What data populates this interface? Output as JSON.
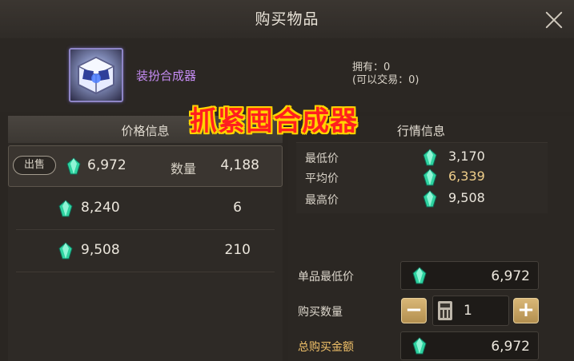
{
  "window": {
    "title": "购买物品",
    "close_icon": "close-icon"
  },
  "item": {
    "name": "装扮合成器",
    "owned_line": "拥有：0",
    "tradable_line": "(可以交易：0)",
    "icon": "cube-synthesizer-icon"
  },
  "overlay": {
    "text": "抓紧囤合成器",
    "fill_color": "#ff1f1f",
    "outline_color": "#ffd400"
  },
  "price_panel": {
    "header": "价格信息",
    "sell_tag": "出售",
    "qty_label": "数量",
    "rows": [
      {
        "price": "6,972",
        "qty": "4,188"
      },
      {
        "price": "8,240",
        "qty": "6"
      },
      {
        "price": "9,508",
        "qty": "210"
      }
    ]
  },
  "market": {
    "header": "行情信息",
    "items": [
      {
        "label": "最低价",
        "value": "3,170"
      },
      {
        "label": "平均价",
        "value": "6,339"
      },
      {
        "label": "最高价",
        "value": "9,508"
      }
    ]
  },
  "purchase": {
    "unit_min_label": "单品最低价",
    "unit_min_value": "6,972",
    "qty_label": "购买数量",
    "minus": "−",
    "plus": "+",
    "qty_value": "1",
    "total_label": "总购买金额",
    "total_value": "6,972"
  },
  "colors": {
    "gem": "#2fd3a0",
    "accent_gold": "#c9a462",
    "item_name": "#c58cf3"
  }
}
